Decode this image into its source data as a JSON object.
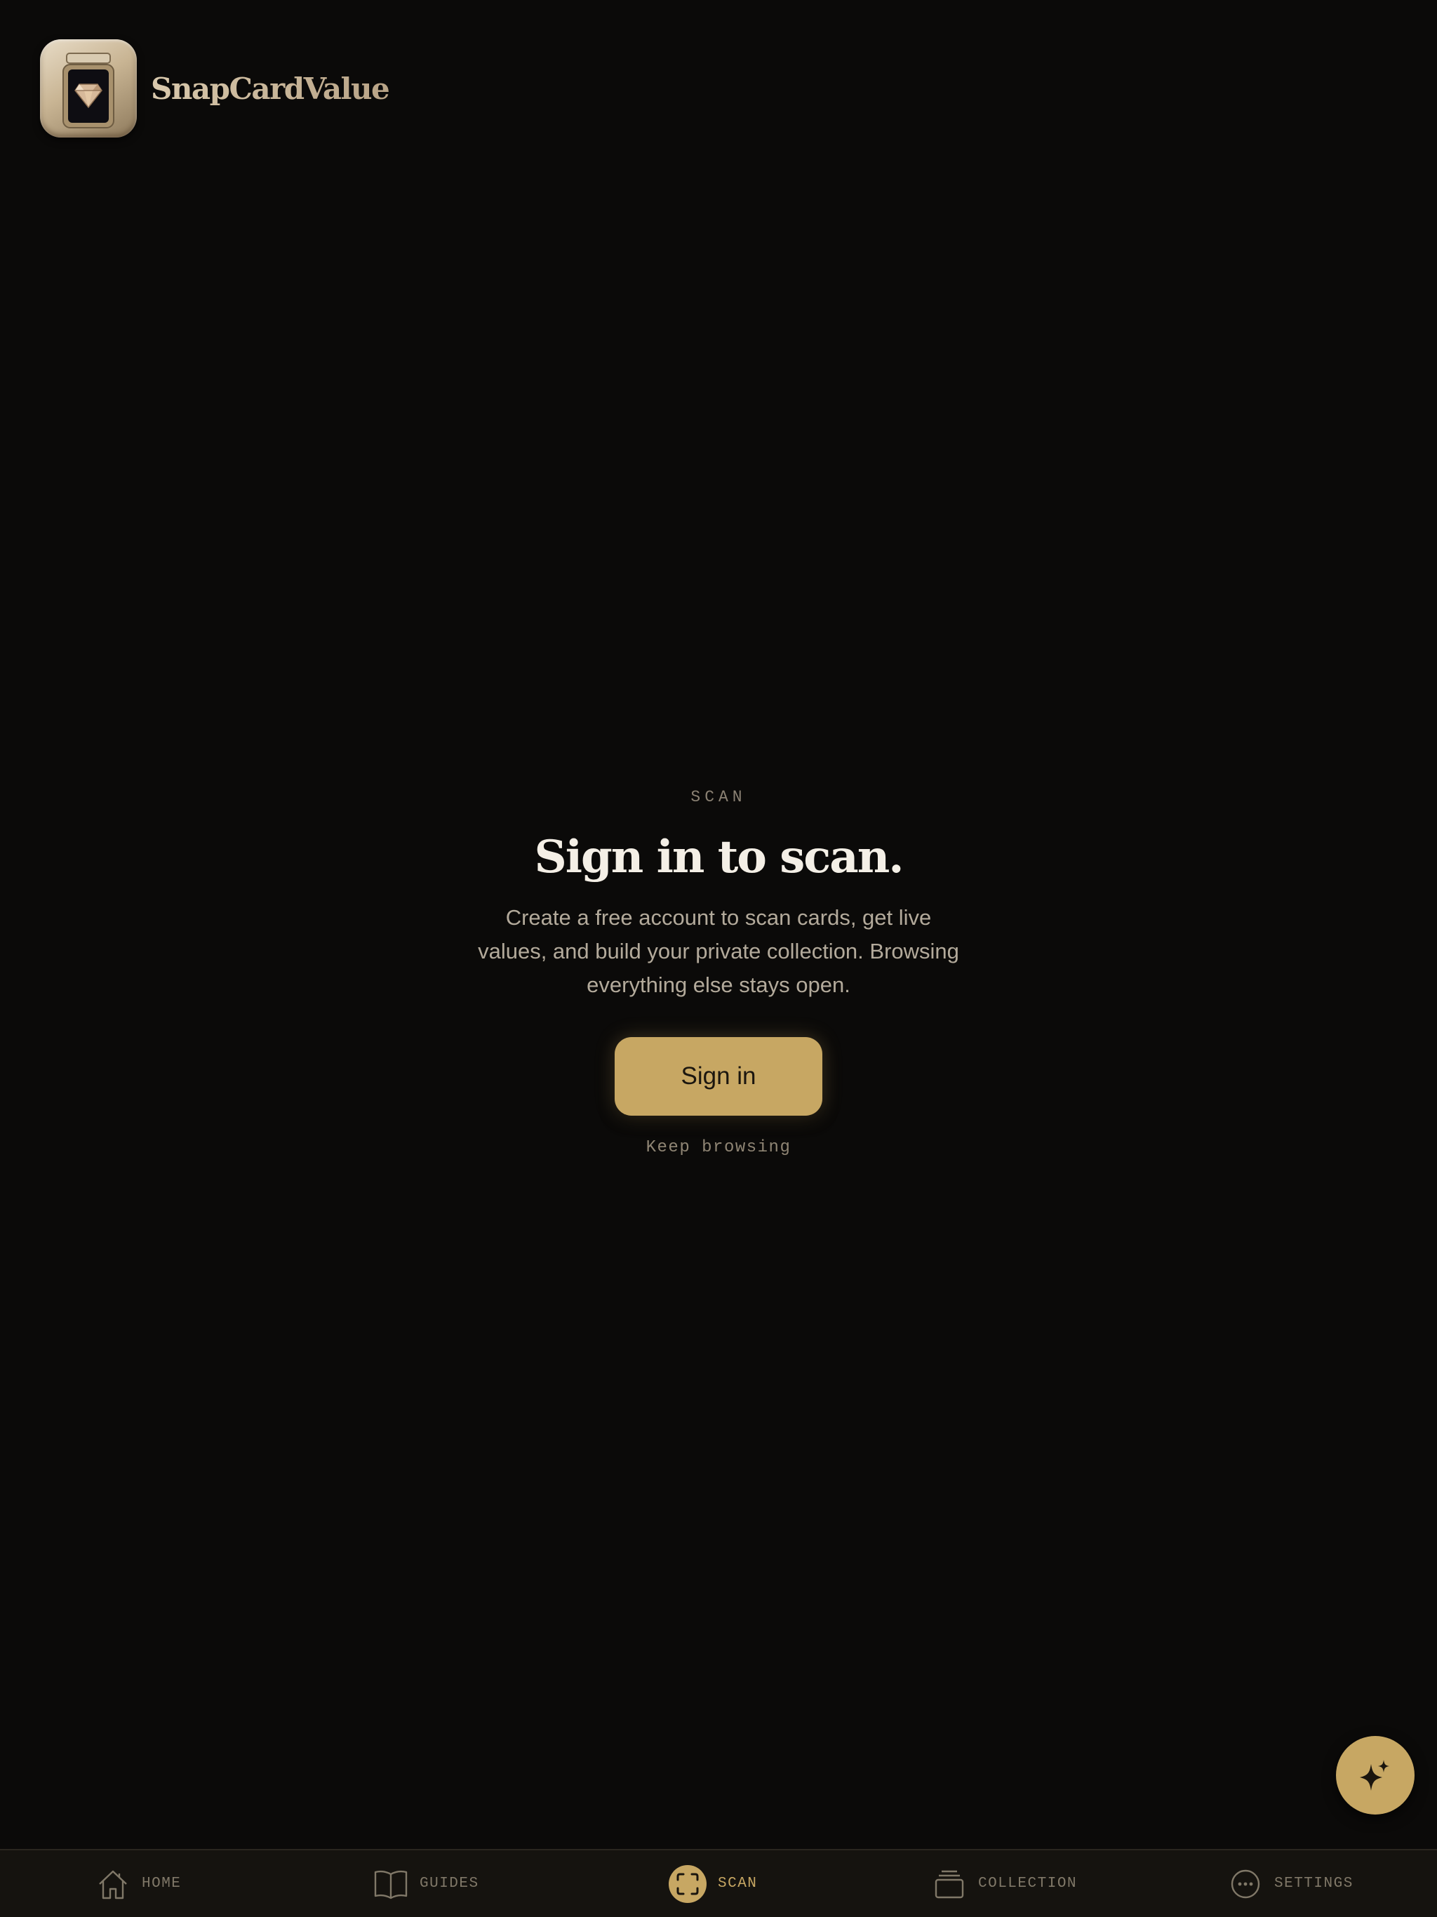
{
  "app": {
    "brand_name": "SnapCardValue"
  },
  "main": {
    "eyebrow": "SCAN",
    "title": "Sign in to scan.",
    "subtitle": "Create a free account to scan cards, get live values, and build your private collection. Browsing everything else stays open.",
    "primary_button": "Sign in",
    "secondary_link": "Keep browsing"
  },
  "fab": {
    "icon": "sparkles-icon"
  },
  "nav": {
    "items": [
      {
        "label": "HOME",
        "icon": "home-icon",
        "active": false
      },
      {
        "label": "GUIDES",
        "icon": "book-icon",
        "active": false
      },
      {
        "label": "SCAN",
        "icon": "scan-icon",
        "active": true
      },
      {
        "label": "COLLECTION",
        "icon": "collection-icon",
        "active": false
      },
      {
        "label": "SETTINGS",
        "icon": "more-icon",
        "active": false
      }
    ]
  },
  "colors": {
    "background": "#0b0a09",
    "accent": "#c7a763",
    "nav_background": "#15130f",
    "muted_text": "#807868"
  }
}
